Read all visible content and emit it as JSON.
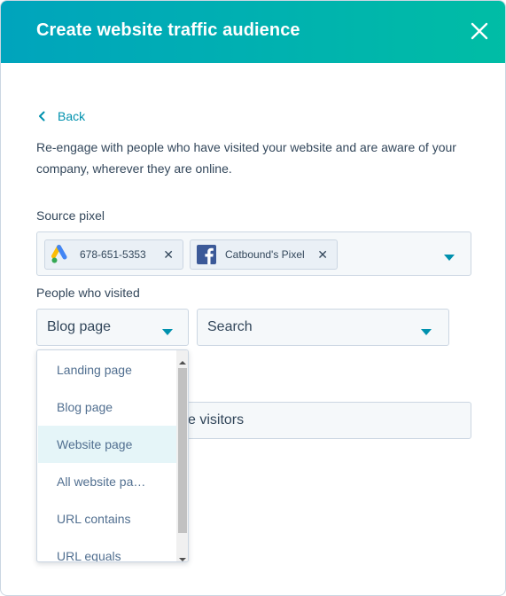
{
  "header": {
    "title": "Create website traffic audience"
  },
  "back_label": "Back",
  "description": "Re-engage with people who have visited your website and are aware of your company, wherever they are online.",
  "source_pixel": {
    "label": "Source pixel",
    "chips": [
      {
        "label": "678-651-5353",
        "icon": "google-ads-icon"
      },
      {
        "label": "Catbound's Pixel",
        "icon": "facebook-icon"
      }
    ]
  },
  "visited": {
    "label": "People who visited",
    "page_select_value": "Blog page",
    "search_placeholder": "Search"
  },
  "visitors_field": {
    "partial_text": "e visitors"
  },
  "dropdown": {
    "options": [
      "Landing page",
      "Blog page",
      "Website page",
      "All website pa…",
      "URL contains",
      "URL equals"
    ],
    "selected": "Website page"
  },
  "colors": {
    "header_gradient_start": "#00a4bd",
    "header_gradient_end": "#00bda5",
    "link": "#0091ae",
    "text": "#33475b",
    "caret": "#0091ae"
  }
}
